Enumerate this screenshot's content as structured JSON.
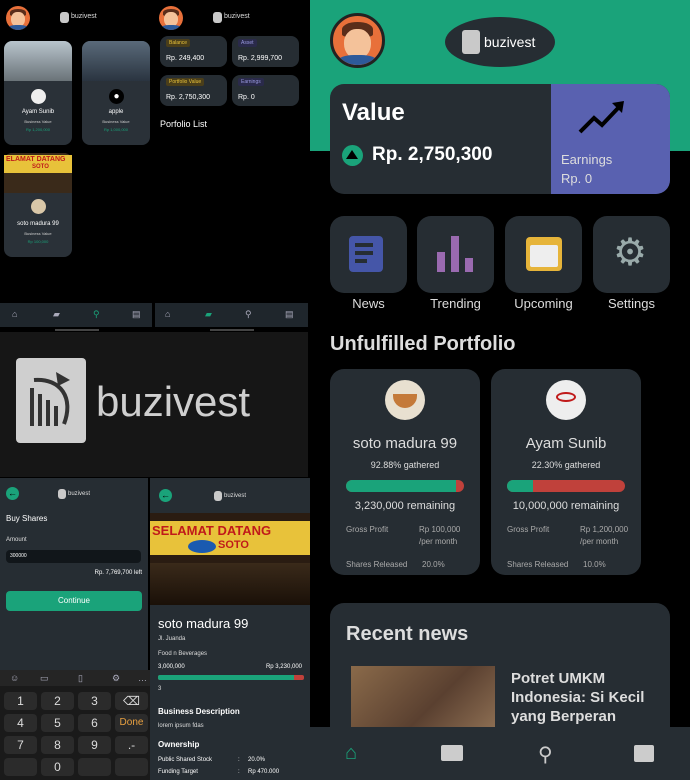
{
  "brand": "buzivest",
  "home_small": {
    "cards": [
      {
        "name": "Ayam Sunib",
        "label": "Business Value",
        "value": "Rp 1,200,000"
      },
      {
        "name": "apple",
        "label": "Business Value",
        "value": "Rp 1,000,000"
      },
      {
        "name": "soto madura 99",
        "label": "Business Value",
        "value": "Rp 100,000"
      }
    ],
    "sign_text": "ELAMAT DATANG",
    "sign_soto": "SOTO"
  },
  "portfolio_small": {
    "tiles": [
      {
        "label": "Balance",
        "value": "Rp. 249,400"
      },
      {
        "label": "Asset",
        "value": "Rp. 2,999,700"
      },
      {
        "label": "Portfolio Value",
        "value": "Rp. 2,750,300"
      },
      {
        "label": "Earnings",
        "value": "Rp. 0"
      }
    ],
    "list_title": "Porfolio List"
  },
  "splash": {
    "brand": "buzivest"
  },
  "buy": {
    "title": "Buy Shares",
    "amount_label": "Amount",
    "amount_value": "300000",
    "balance_left": "Rp. 7,769,700 left",
    "continue": "Continue",
    "keys": [
      "1",
      "2",
      "3",
      "⌫",
      "4",
      "5",
      "6",
      "Done",
      "7",
      "8",
      "9",
      ".-",
      "",
      "0",
      "",
      ""
    ]
  },
  "detail": {
    "sign_text": "SELAMAT DATANG",
    "sign_soto": "SOTO",
    "name": "soto madura 99",
    "address": "Jl. Juanda",
    "category": "Food n Beverages",
    "progress_left": "3,000,000",
    "progress_right": "Rp 3,230,000",
    "progress_fraction": 0.93,
    "count": "3",
    "desc_title": "Business Description",
    "desc": "lorem ipsum fdas",
    "ownership_title": "Ownership",
    "ownership": [
      {
        "label": "Public Shared Stock",
        "sep": ":",
        "value": "20.0%"
      },
      {
        "label": "Funding Target",
        "sep": ":",
        "value": "Rp 470.000"
      }
    ]
  },
  "main": {
    "value_title": "Value",
    "value_amount": "Rp. 2,750,300",
    "earnings_label": "Earnings",
    "earnings_value": "Rp. 0",
    "menu": [
      {
        "label": "News",
        "icon": "news-icon"
      },
      {
        "label": "Trending",
        "icon": "trending-icon"
      },
      {
        "label": "Upcoming",
        "icon": "calendar-icon"
      },
      {
        "label": "Settings",
        "icon": "gear-icon"
      }
    ],
    "unfulfilled_title": "Unfulfilled Portfolio",
    "portfolio": [
      {
        "name": "soto madura 99",
        "gathered": "92.88% gathered",
        "fraction": 0.9288,
        "remaining": "3,230,000 remaining",
        "gross_label": "Gross Profit",
        "gross_value": "Rp 100,000",
        "gross_period": "/per month",
        "shares_label": "Shares Released",
        "shares_value": "20.0%"
      },
      {
        "name": "Ayam Sunib",
        "gathered": "22.30% gathered",
        "fraction": 0.223,
        "remaining": "10,000,000 remaining",
        "gross_label": "Gross Profit",
        "gross_value": "Rp 1,200,000",
        "gross_period": "/per month",
        "shares_label": "Shares Released",
        "shares_value": "10.0%"
      }
    ],
    "news_title": "Recent news",
    "news_headline": "Potret UMKM Indonesia: Si Kecil yang Berperan"
  },
  "colors": {
    "accent": "#1aa37a",
    "red": "#c0413b",
    "card": "#262d33",
    "earnings": "#5961b0"
  }
}
